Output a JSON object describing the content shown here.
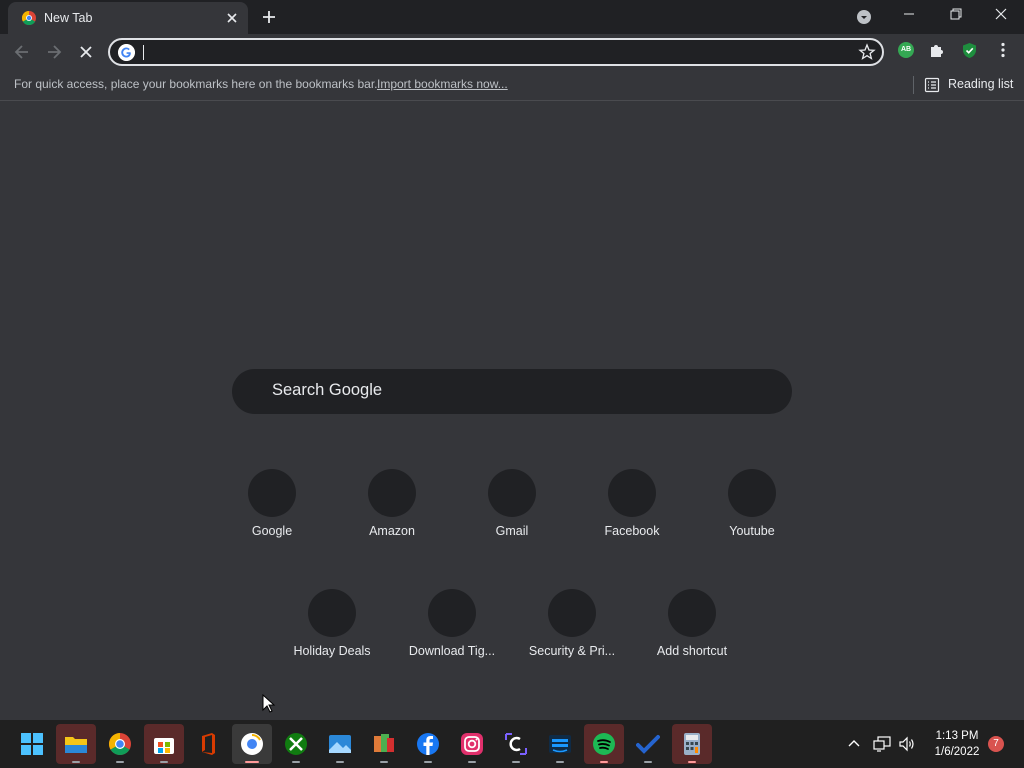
{
  "tab": {
    "title": "New Tab"
  },
  "omnibox": {
    "value": ""
  },
  "bookmarks_bar": {
    "hint": "For quick access, place your bookmarks here on the bookmarks bar.",
    "import_link": "Import bookmarks now...",
    "reading_list": "Reading list"
  },
  "extensions": {
    "ab_badge": "AB"
  },
  "search": {
    "placeholder": "Search Google"
  },
  "shortcuts_row1": [
    {
      "label": "Google"
    },
    {
      "label": "Amazon"
    },
    {
      "label": "Gmail"
    },
    {
      "label": "Facebook"
    },
    {
      "label": "Youtube"
    }
  ],
  "shortcuts_row2": [
    {
      "label": "Holiday Deals"
    },
    {
      "label": "Download Tig..."
    },
    {
      "label": "Security & Pri..."
    },
    {
      "label": "Add shortcut"
    }
  ],
  "taskbar": {
    "apps": [
      {
        "name": "start-icon",
        "color": "#1e90ff"
      },
      {
        "name": "file-explorer-icon",
        "color": "#f5c518"
      },
      {
        "name": "chrome-icon",
        "color": "#4285f4"
      },
      {
        "name": "microsoft-store-icon",
        "color": "#ffffff"
      },
      {
        "name": "office-icon",
        "color": "#d83b01"
      },
      {
        "name": "chrome-canary-icon",
        "color": "#ffffff"
      },
      {
        "name": "xbox-icon",
        "color": "#107c10"
      },
      {
        "name": "photos-icon",
        "color": "#2b88d8"
      },
      {
        "name": "app-icon",
        "color": "#e07b39"
      },
      {
        "name": "facebook-icon",
        "color": "#1877f2"
      },
      {
        "name": "instagram-icon",
        "color": "#e1306c"
      },
      {
        "name": "clipchamp-icon",
        "color": "#7b61ff"
      },
      {
        "name": "prime-video-icon",
        "color": "#1a98ff"
      },
      {
        "name": "spotify-icon",
        "color": "#1db954"
      },
      {
        "name": "todo-icon",
        "color": "#2564cf"
      },
      {
        "name": "calculator-icon",
        "color": "#9ab0c8"
      }
    ],
    "time": "1:13 PM",
    "date": "1/6/2022",
    "notification_count": "7"
  }
}
